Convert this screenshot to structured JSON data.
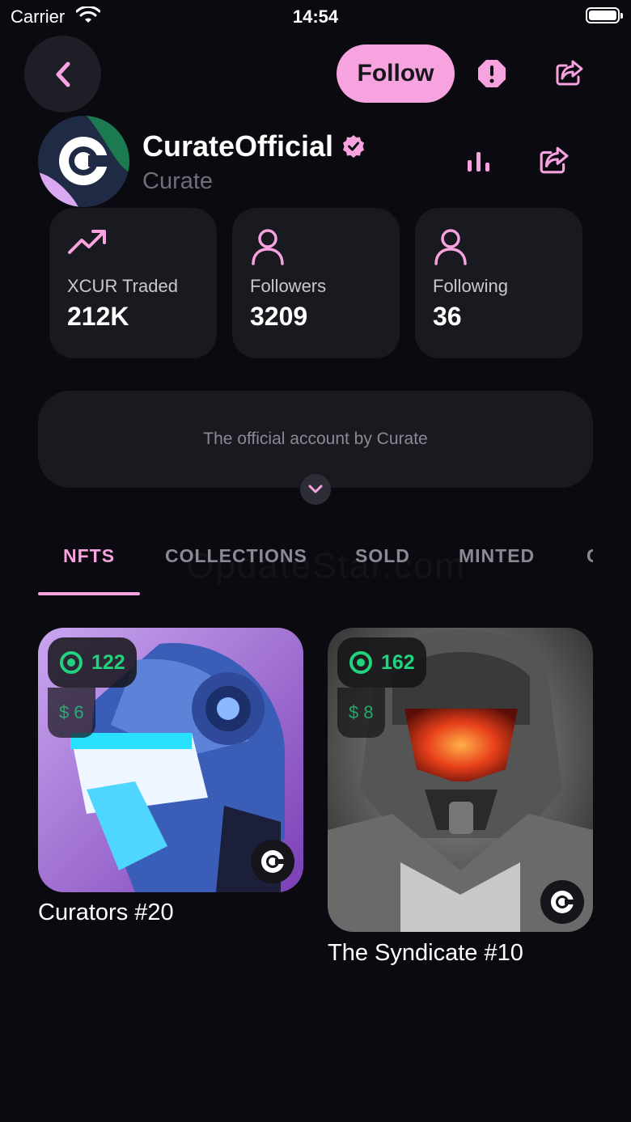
{
  "status_bar": {
    "carrier": "Carrier",
    "time": "14:54"
  },
  "header": {
    "follow_label": "Follow"
  },
  "profile": {
    "name": "CurateOfficial",
    "handle": "Curate"
  },
  "stats": [
    {
      "label": "XCUR Traded",
      "value": "212K",
      "icon": "trending-up-icon"
    },
    {
      "label": "Followers",
      "value": "3209",
      "icon": "user-icon"
    },
    {
      "label": "Following",
      "value": "36",
      "icon": "user-icon"
    }
  ],
  "bio": {
    "text": "The official account by Curate"
  },
  "tabs": [
    {
      "label": "NFTS",
      "active": true
    },
    {
      "label": "COLLECTIONS",
      "active": false
    },
    {
      "label": "SOLD",
      "active": false
    },
    {
      "label": "MINTED",
      "active": false
    },
    {
      "label": "C",
      "active": false
    }
  ],
  "watermark": "OpdateStar.com",
  "nfts": [
    {
      "price_xcur": "122",
      "price_usd": "$ 6",
      "title": "Curators  #20"
    },
    {
      "price_xcur": "162",
      "price_usd": "$ 8",
      "title": "The Syndicate  #10"
    }
  ],
  "colors": {
    "accent": "#f6a3df",
    "background": "#0a0a10",
    "card": "#191920",
    "price_green": "#22d37e"
  }
}
